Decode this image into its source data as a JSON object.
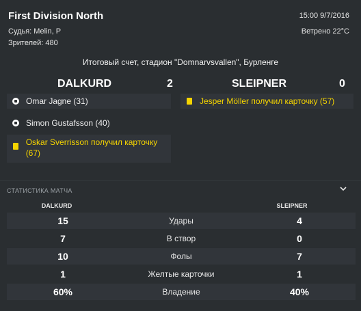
{
  "header": {
    "league": "First Division North",
    "referee": "Судья: Melin, P",
    "attendance": "Зрителей: 480",
    "datetime": "15:00 9/7/2016",
    "weather": "Ветрено 22°C",
    "summary": "Итоговый счет, стадион \"Domnarvsvallen\", Бурленге"
  },
  "score": {
    "home_team": "DALKURD",
    "home_score": "2",
    "away_team": "SLEIPNER",
    "away_score": "0"
  },
  "events": {
    "home": [
      {
        "icon": "goal-ball-icon",
        "text": "Omar Jagne (31)"
      },
      {
        "icon": "goal-ball-icon",
        "text": "Simon Gustafsson (40)"
      },
      {
        "icon": "yellow-card-icon",
        "text": "Oskar Sverrisson получил карточку (67)"
      }
    ],
    "away": [
      {
        "icon": "yellow-card-icon",
        "text": "Jesper Möller получил карточку (57)"
      }
    ]
  },
  "stats": {
    "title": "СТАТИСТИКА МАТЧА",
    "home_label": "DALKURD",
    "away_label": "SLEIPNER",
    "rows": [
      {
        "label": "Удары",
        "home": "15",
        "away": "4"
      },
      {
        "label": "В створ",
        "home": "7",
        "away": "0"
      },
      {
        "label": "Фолы",
        "home": "10",
        "away": "7"
      },
      {
        "label": "Желтые карточки",
        "home": "1",
        "away": "1"
      },
      {
        "label": "Владение",
        "home": "60%",
        "away": "40%"
      }
    ]
  },
  "colors": {
    "background": "#2a2e31",
    "row_shade": "#31353a",
    "yellow": "#f5d400"
  }
}
